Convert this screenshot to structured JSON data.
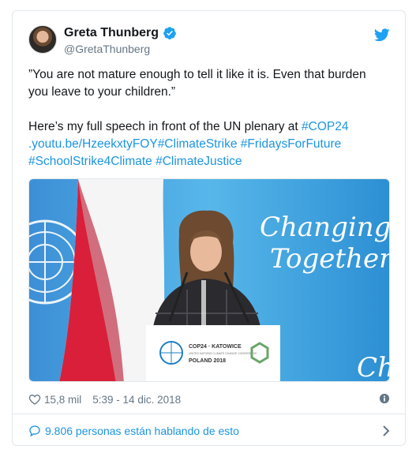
{
  "tweet": {
    "author": {
      "display_name": "Greta Thunberg",
      "handle": "@GretaThunberg"
    },
    "text": {
      "quote_line1": "”You are not mature enough to tell it like it is. Even that burden",
      "quote_line2": "you leave to your children.”",
      "speech_prefix": "Here’s my full speech in front of the UN plenary at ",
      "tag_cop24": "#COP24",
      "url": ".youtu.be/HzeekxtyFOY",
      "tag_climatestrike": "#ClimateStrike",
      "tag_fridays": "#FridaysForFuture",
      "tag_schoolstrike": "#SchoolStrike4Climate",
      "tag_justice": "#ClimateJustice"
    },
    "media": {
      "banner_line1": "Changing",
      "banner_line2": "Together",
      "banner_partial": "Ch",
      "podium_line1": "COP24 · KATOWICE",
      "podium_line2": "UNITED NATIONS CLIMATE CHANGE CONFERENCE",
      "podium_line3": "POLAND 2018"
    },
    "likes": "15,8 mil",
    "timestamp": "5:39 - 14 dic. 2018",
    "talking": "9.806 personas están hablando de esto"
  },
  "colors": {
    "link": "#1b95e0",
    "secondary_text": "#657786",
    "verified": "#1da1f2",
    "border": "#e1e8ed"
  },
  "icons": [
    "verified-badge-icon",
    "twitter-bird-icon",
    "heart-icon",
    "info-icon",
    "speech-bubble-icon",
    "chevron-right-icon"
  ]
}
